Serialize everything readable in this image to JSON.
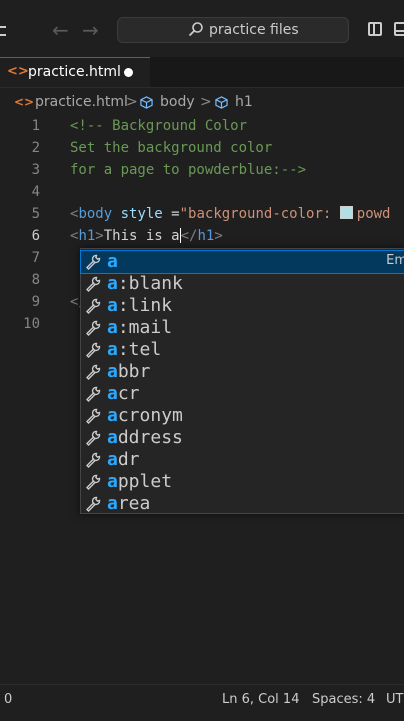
{
  "titlebar": {
    "search_text": "practice files"
  },
  "tab": {
    "label": "practice.html"
  },
  "breadcrumb": {
    "file": "practice.html",
    "sep": ">",
    "item1": "body",
    "item2": "h1"
  },
  "editor": {
    "line_numbers": [
      "1",
      "2",
      "3",
      "4",
      "5",
      "6",
      "7",
      "8",
      "9",
      "10"
    ],
    "lines": {
      "l1": "<!-- Background Color",
      "l2": "Set the background color",
      "l3": "for a page to powderblue:-->",
      "l5_open": "<",
      "l5_tag": "body",
      "l5_attr": "style",
      "l5_eq": " =",
      "l5_str_a": "\"background-color: ",
      "l5_str_b": "powd",
      "l6_open": "<",
      "l6_tag": "h1",
      "l6_close": ">",
      "l6_text": "This is a",
      "l6_end_open": "</",
      "l6_end_tag": "h1",
      "l6_end_close": ">",
      "l9_partial": "</"
    },
    "swatch_color": "#b0e0e6"
  },
  "suggest": {
    "items": [
      {
        "hl": "a",
        "rest": ""
      },
      {
        "hl": "a",
        "rest": ":blank"
      },
      {
        "hl": "a",
        "rest": ":link"
      },
      {
        "hl": "a",
        "rest": ":mail"
      },
      {
        "hl": "a",
        "rest": ":tel"
      },
      {
        "hl": "a",
        "rest": "bbr"
      },
      {
        "hl": "a",
        "rest": "cr"
      },
      {
        "hl": "a",
        "rest": "cronym"
      },
      {
        "hl": "a",
        "rest": "ddress"
      },
      {
        "hl": "a",
        "rest": "dr"
      },
      {
        "hl": "a",
        "rest": "pplet"
      },
      {
        "hl": "a",
        "rest": "rea"
      }
    ],
    "selected_kind": "Em"
  },
  "statusbar": {
    "left": "0",
    "position": "Ln 6, Col 14",
    "spaces": "Spaces: 4",
    "encoding": "UT"
  },
  "colors": {
    "background": "#1f1f1f",
    "accent": "#0078d4",
    "comment": "#6a9955",
    "tag": "#569cd6",
    "attribute": "#9cdcfe",
    "string": "#ce9178",
    "match_highlight": "#2aaaff"
  }
}
